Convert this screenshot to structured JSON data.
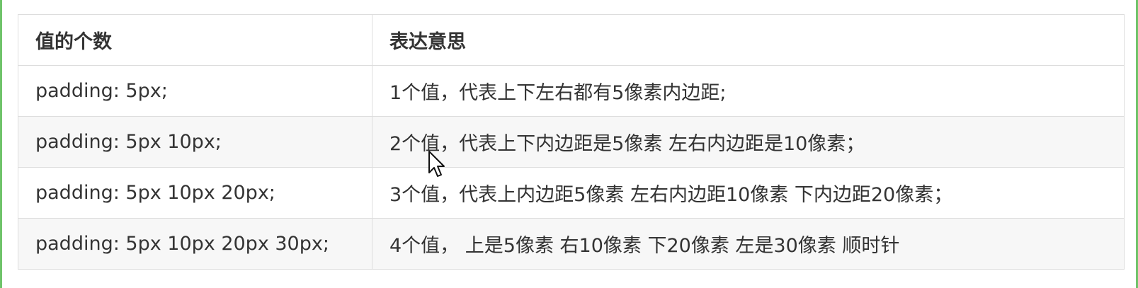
{
  "table": {
    "headers": [
      "值的个数",
      "表达意思"
    ],
    "rows": [
      [
        "padding: 5px;",
        "1个值，代表上下左右都有5像素内边距;"
      ],
      [
        "padding: 5px 10px;",
        "2个值，代表上下内边距是5像素   左右内边距是10像素；"
      ],
      [
        "padding: 5px 10px 20px;",
        "3个值，代表上内边距5像素   左右内边距10像素   下内边距20像素；"
      ],
      [
        "padding: 5px 10px 20px 30px;",
        "4个值，  上是5像素 右10像素 下20像素 左是30像素    顺时针"
      ]
    ]
  },
  "colors": {
    "border": "#dddddd",
    "stripe": "#f7f7f7",
    "text": "#333333",
    "frame": "#6fc36a"
  },
  "icons": {
    "cursor": "mouse-pointer-icon"
  }
}
